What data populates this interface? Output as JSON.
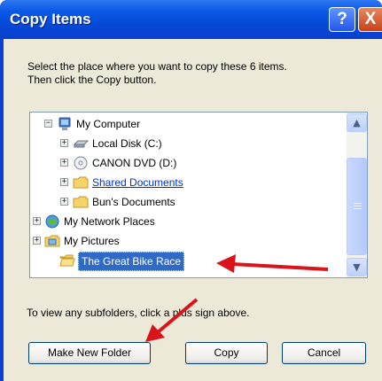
{
  "dialog": {
    "title": "Copy Items",
    "help_symbol": "?",
    "close_symbol": "X",
    "prompt_line1": "Select the place where you want to copy these 6 items.",
    "prompt_line2": "Then click the Copy button.",
    "hint": "To view any subfolders, click a plus sign above."
  },
  "tree": {
    "items": [
      {
        "label": "My Computer",
        "expander": "−",
        "icon": "computer-icon"
      },
      {
        "label": "Local Disk (C:)",
        "expander": "+",
        "icon": "hard-disk-icon"
      },
      {
        "label": "CANON DVD (D:)",
        "expander": "+",
        "icon": "dvd-drive-icon"
      },
      {
        "label": "Shared Documents",
        "expander": "+",
        "icon": "folder-icon"
      },
      {
        "label": "Bun's Documents",
        "expander": "+",
        "icon": "folder-icon"
      },
      {
        "label": "My Network Places",
        "expander": "+",
        "icon": "network-icon"
      },
      {
        "label": "My Pictures",
        "expander": "+",
        "icon": "pictures-folder-icon"
      },
      {
        "label": "The Great Bike Race",
        "expander": "",
        "icon": "open-folder-icon",
        "selected": true
      }
    ]
  },
  "scrollbar": {
    "up_symbol": "▲",
    "down_symbol": "▼"
  },
  "buttons": {
    "make_new_folder": "Make New Folder",
    "copy": "Copy",
    "cancel": "Cancel"
  },
  "colors": {
    "title_bar": "#0a57e6",
    "selection": "#316ac5",
    "annotation_arrow": "#d9141b"
  }
}
